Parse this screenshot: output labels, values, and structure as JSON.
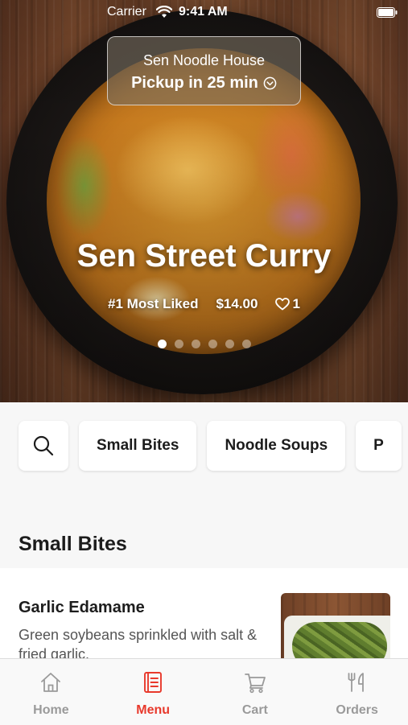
{
  "status_bar": {
    "carrier": "Carrier",
    "time": "9:41 AM"
  },
  "pickup": {
    "store_name": "Sen Noodle House",
    "eta": "Pickup in 25 min"
  },
  "featured": {
    "title": "Sen Street Curry",
    "rank": "#1 Most Liked",
    "price": "$14.00",
    "likes": "1",
    "carousel": {
      "count": 6,
      "active_index": 0
    }
  },
  "categories": [
    "Small Bites",
    "Noodle Soups",
    "P"
  ],
  "section": {
    "title": "Small Bites"
  },
  "items": [
    {
      "name": "Garlic Edamame",
      "description": "Green soybeans sprinkled with salt & fried garlic."
    }
  ],
  "tabs": [
    {
      "label": "Home",
      "icon": "home-icon",
      "active": false
    },
    {
      "label": "Menu",
      "icon": "menu-icon",
      "active": true
    },
    {
      "label": "Cart",
      "icon": "cart-icon",
      "active": false
    },
    {
      "label": "Orders",
      "icon": "orders-icon",
      "active": false
    }
  ],
  "colors": {
    "accent": "#e8392c",
    "inactive_tab": "#9a9a9a"
  }
}
